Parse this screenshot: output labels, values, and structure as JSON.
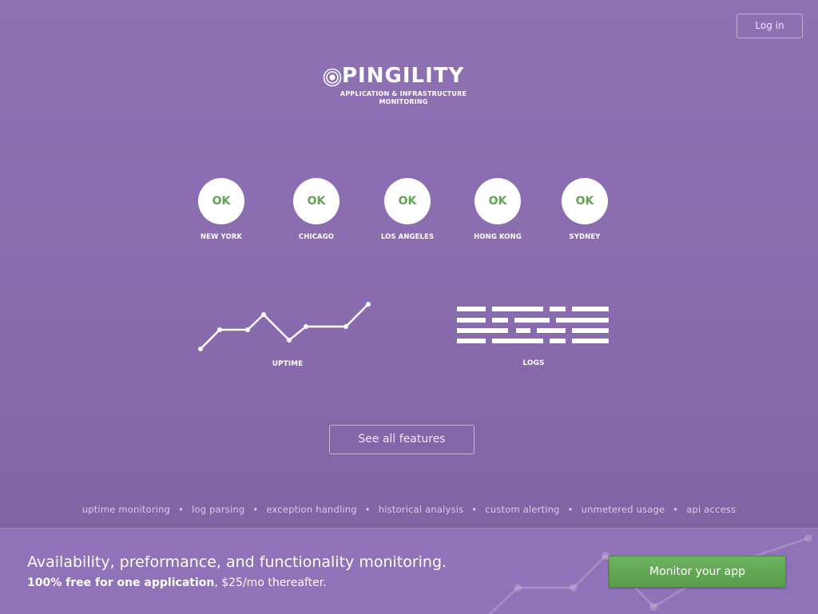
{
  "header": {
    "login_label": "Log in"
  },
  "brand": {
    "name": "PINGILITY",
    "tagline_line1": "APPLICATION & INFRASTRUCTURE",
    "tagline_line2": "MONITORING"
  },
  "locations": [
    {
      "status": "OK",
      "city": "NEW YORK"
    },
    {
      "status": "OK",
      "city": "CHICAGO"
    },
    {
      "status": "OK",
      "city": "LOS ANGELES"
    },
    {
      "status": "OK",
      "city": "HONG KONG"
    },
    {
      "status": "OK",
      "city": "SYDNEY"
    }
  ],
  "feature_graphics": {
    "uptime_label": "UPTIME",
    "logs_label": "LOGS"
  },
  "see_all_label": "See all features",
  "features": [
    "uptime monitoring",
    "log parsing",
    "exception handling",
    "historical analysis",
    "custom alerting",
    "unmetered usage",
    "api access"
  ],
  "feature_separator": "•",
  "cta": {
    "headline": "Availability, preformance, and functionality monitoring.",
    "pricing_bold": "100% free for one application",
    "pricing_rest": ", $25/mo thereafter.",
    "button_label": "Monitor your app"
  },
  "colors": {
    "background": "#8a6db0",
    "ok_green": "#5fa551",
    "button_green": "#65a957"
  }
}
